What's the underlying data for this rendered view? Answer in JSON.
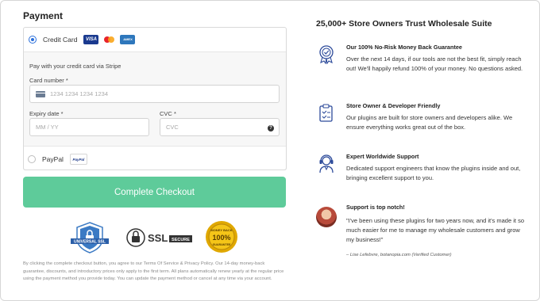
{
  "payment": {
    "title": "Payment",
    "credit_card_label": "Credit Card",
    "card_logos": [
      "VISA",
      "mastercard",
      "AMEX"
    ],
    "stripe_text": "Pay with your credit card via Stripe",
    "card_number_label": "Card number",
    "card_number_placeholder": "1234 1234 1234 1234",
    "expiry_label": "Expiry date",
    "expiry_placeholder": "MM / YY",
    "cvc_label": "CVC",
    "cvc_placeholder": "CVC",
    "required_mark": "*",
    "paypal_label": "PayPal",
    "paypal_logo_text": "PayPal",
    "checkout_button": "Complete Checkout",
    "disclaimer": "By clicking the complete checkout button, you agree to our Terms Of Service & Privacy Policy. Our 14-day money-back guarantee, discounts, and introductory prices only apply to the first term. All plans automatically renew yearly at the regular price using the payment method you provide today. You can update the payment method or cancel at any time via your account.",
    "badges": {
      "universal_ssl": "UNIVERSAL SSL",
      "ssl_secure_main": "SSL",
      "ssl_secure_sub": "SECURE",
      "money_back": "MONEY BACK",
      "money_back_pct": "100%",
      "money_back_sub": "GUARANTEE"
    }
  },
  "trust": {
    "title": "25,000+ Store Owners Trust Wholesale Suite",
    "features": [
      {
        "icon": "award-ribbon-icon",
        "title": "Our 100% No-Risk Money Back Guarantee",
        "desc": "Over the next 14 days, if our tools are not the best fit, simply reach out! We'll happily refund 100% of your money. No questions asked."
      },
      {
        "icon": "clipboard-check-icon",
        "title": "Store Owner & Developer Friendly",
        "desc": "Our plugins are built for store owners and developers alike. We ensure everything works great out of the box."
      },
      {
        "icon": "support-agent-icon",
        "title": "Expert Worldwide Support",
        "desc": "Dedicated support engineers that know the plugins inside and out, bringing excellent support to you."
      }
    ],
    "testimonial": {
      "title": "Support is top notch!",
      "quote": "\"I've been using these plugins for two years now, and it's made it so much easier for me to manage my wholesale customers and grow my business!\"",
      "author": "– Lise Lefebvre, botanopia.com (Verified Customer)"
    }
  },
  "colors": {
    "accent_green": "#5ecb9a",
    "radio_blue": "#2a6fdb",
    "icon_blue": "#2c4a9a"
  }
}
